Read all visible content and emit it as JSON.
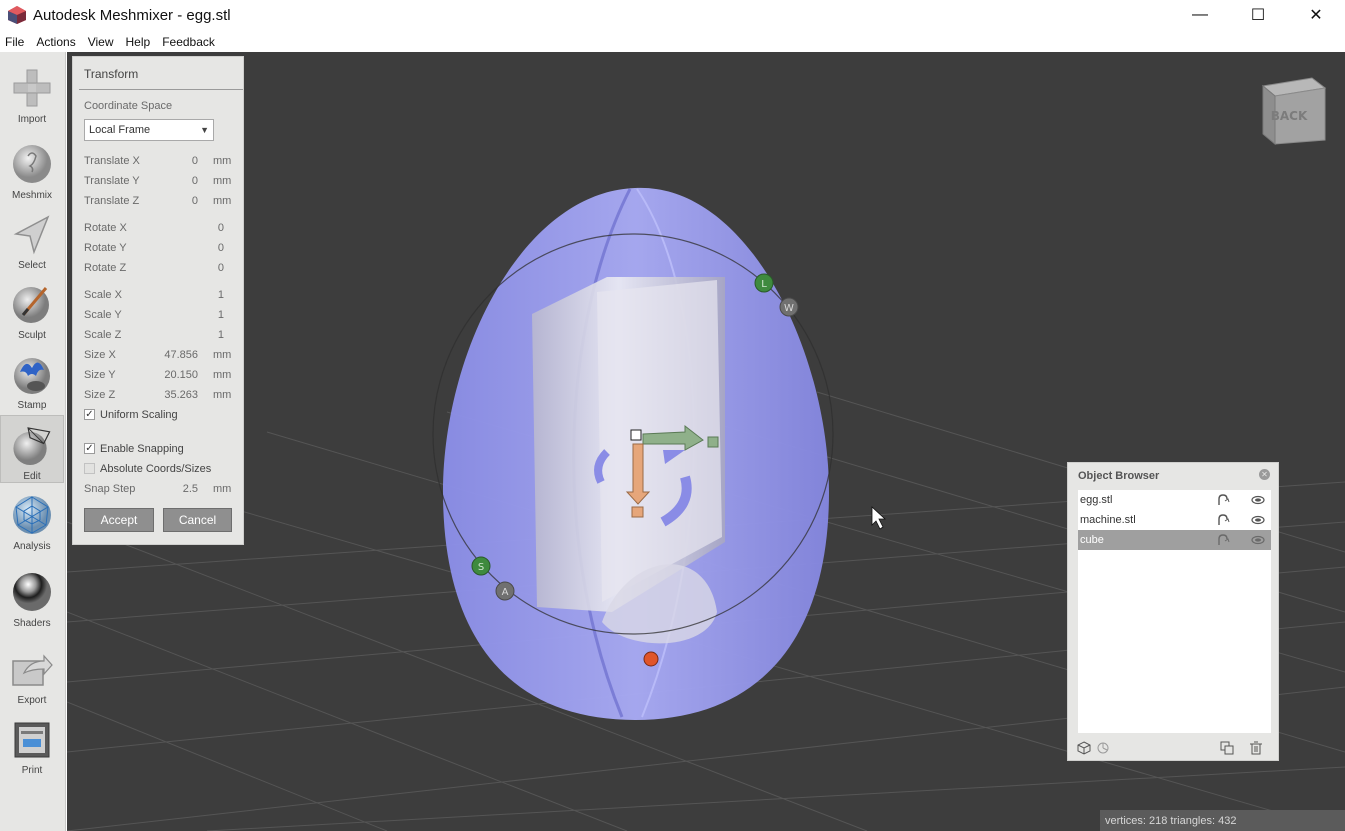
{
  "window": {
    "title": "Autodesk Meshmixer - egg.stl",
    "minimize_glyph": "—",
    "maximize_glyph": "☐",
    "close_glyph": "✕"
  },
  "menu": {
    "items": [
      "File",
      "Actions",
      "View",
      "Help",
      "Feedback"
    ]
  },
  "toolbar": {
    "tools": [
      {
        "label": "Import",
        "icon": "plus-icon"
      },
      {
        "label": "Meshmix",
        "icon": "bunny-sphere-icon"
      },
      {
        "label": "Select",
        "icon": "arrow-cursor-icon"
      },
      {
        "label": "Sculpt",
        "icon": "brush-sphere-icon"
      },
      {
        "label": "Stamp",
        "icon": "stamp-icon"
      },
      {
        "label": "Edit",
        "icon": "edit-mesh-icon"
      },
      {
        "label": "Analysis",
        "icon": "mesh-sphere-icon"
      },
      {
        "label": "Shaders",
        "icon": "chrome-sphere-icon"
      },
      {
        "label": "Export",
        "icon": "export-icon"
      },
      {
        "label": "Print",
        "icon": "printer-icon"
      }
    ],
    "active_tool": "Edit"
  },
  "transform": {
    "title": "Transform",
    "coordinate_space_label": "Coordinate Space",
    "coordinate_space_value": "Local Frame",
    "fields": {
      "translate_x": {
        "label": "Translate X",
        "value": "0",
        "unit": "mm"
      },
      "translate_y": {
        "label": "Translate Y",
        "value": "0",
        "unit": "mm"
      },
      "translate_z": {
        "label": "Translate Z",
        "value": "0",
        "unit": "mm"
      },
      "rotate_x": {
        "label": "Rotate X",
        "value": "0"
      },
      "rotate_y": {
        "label": "Rotate Y",
        "value": "0"
      },
      "rotate_z": {
        "label": "Rotate Z",
        "value": "0"
      },
      "scale_x": {
        "label": "Scale X",
        "value": "1"
      },
      "scale_y": {
        "label": "Scale Y",
        "value": "1"
      },
      "scale_z": {
        "label": "Scale Z",
        "value": "1"
      },
      "size_x": {
        "label": "Size X",
        "value": "47.856",
        "unit": "mm"
      },
      "size_y": {
        "label": "Size Y",
        "value": "20.150",
        "unit": "mm"
      },
      "size_z": {
        "label": "Size Z",
        "value": "35.263",
        "unit": "mm"
      }
    },
    "uniform_scaling": {
      "label": "Uniform Scaling",
      "checked": true
    },
    "enable_snapping": {
      "label": "Enable Snapping",
      "checked": true
    },
    "absolute_coords": {
      "label": "Absolute Coords/Sizes",
      "checked": false
    },
    "snap_step": {
      "label": "Snap Step",
      "value": "2.5",
      "unit": "mm"
    },
    "accept_label": "Accept",
    "cancel_label": "Cancel"
  },
  "viewport": {
    "view_cube_label": "BACK",
    "gizmo_labels": {
      "l": "L",
      "w": "W",
      "s": "S",
      "a": "A"
    }
  },
  "object_browser": {
    "title": "Object Browser",
    "items": [
      {
        "name": "egg.stl",
        "selected": false
      },
      {
        "name": "machine.stl",
        "selected": false
      },
      {
        "name": "cube",
        "selected": true
      }
    ]
  },
  "status": {
    "text": "vertices: 218 triangles: 432"
  },
  "colors": {
    "viewport_bg": "#3d3d3d",
    "egg_fill": "#9a9cf0",
    "panel_bg": "#e6e6e4",
    "selected_row": "#9f9f9f"
  }
}
